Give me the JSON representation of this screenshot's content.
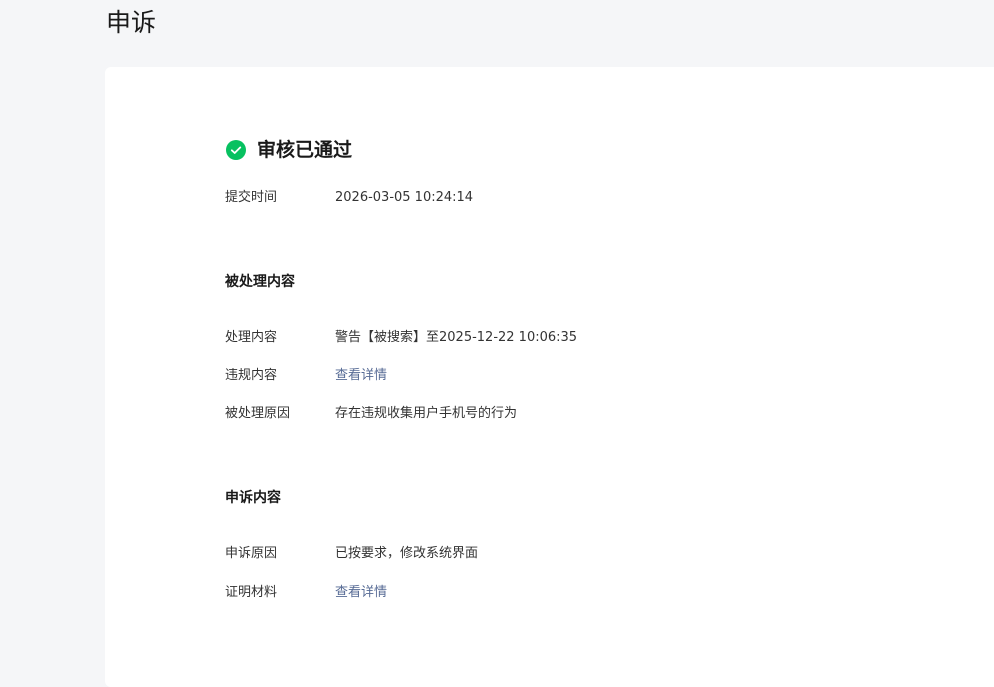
{
  "page": {
    "title": "申诉"
  },
  "status": {
    "icon": "check-circle-icon",
    "color": "#07c160",
    "text": "审核已通过"
  },
  "submit": {
    "label": "提交时间",
    "value": "2026-03-05 10:24:14"
  },
  "handled": {
    "title": "被处理内容",
    "content_label": "处理内容",
    "content_value": "警告【被搜索】至2025-12-22 10:06:35",
    "violation_label": "违规内容",
    "violation_link": "查看详情",
    "reason_label": "被处理原因",
    "reason_value": "存在违规收集用户手机号的行为"
  },
  "appeal": {
    "title": "申诉内容",
    "reason_label": "申诉原因",
    "reason_value": "已按要求，修改系统界面",
    "proof_label": "证明材料",
    "proof_link": "查看详情"
  },
  "colors": {
    "link": "#576b95",
    "success": "#07c160",
    "background": "#f5f6f8"
  }
}
